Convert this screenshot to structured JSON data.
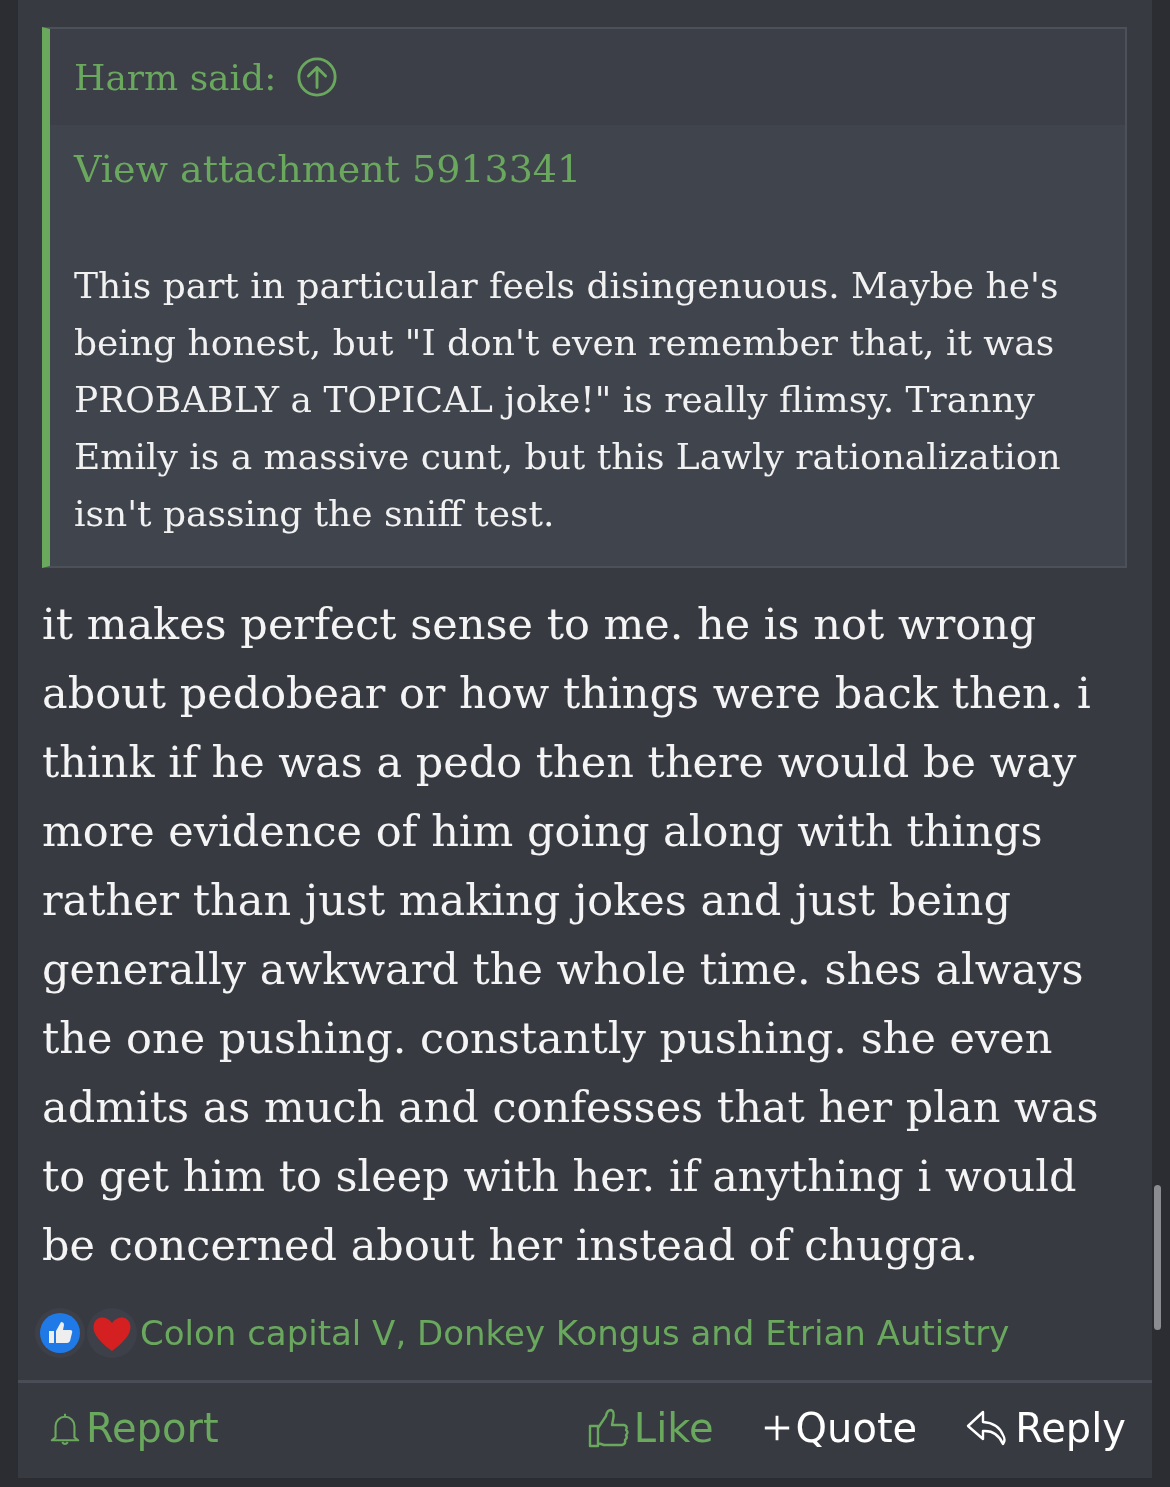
{
  "quote": {
    "author_label": "Harm said:",
    "attachment_link": "View attachment 5913341",
    "text": "This part in particular feels disingenuous. Maybe he's being honest, but \"I don't even remember that, it was PROBABLY a TOPICAL joke!\" is really flimsy. Tranny Emily is a massive cunt, but this Lawly rationalization isn't passing the sniff test."
  },
  "body": "it makes perfect sense to me. he is not wrong about pedobear or how things were back then. i think if he was a pedo then there would be way more evidence of him going along with things rather than just making jokes and just being generally awkward the whole time. shes always the one pushing. constantly pushing. she even admits as much and confesses that her plan was to get him to sleep with her. if anything i would be concerned about her instead of chugga.",
  "reactions": {
    "kinds": [
      {
        "kind": "like"
      },
      {
        "kind": "love"
      }
    ],
    "users": "Colon capital V, Donkey Kongus and Etrian Autistry"
  },
  "actions": [
    {
      "kind": "report",
      "label": "Report"
    },
    {
      "kind": "like",
      "label": "Like"
    },
    {
      "kind": "quote",
      "label": "Quote"
    },
    {
      "kind": "reply",
      "label": "Reply"
    }
  ]
}
